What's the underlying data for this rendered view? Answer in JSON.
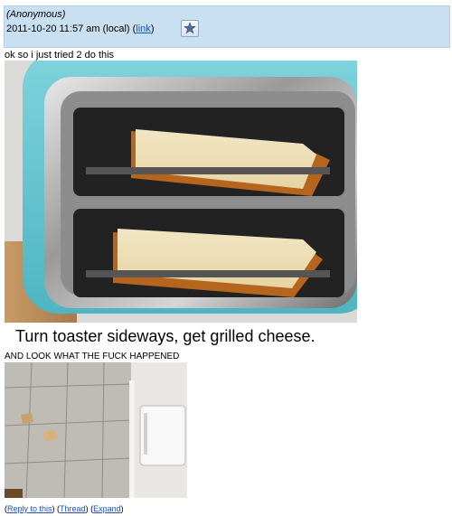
{
  "post": {
    "author": "(Anonymous)",
    "timestamp": "2011-10-20 11:57 am (local)",
    "link_label": "link",
    "star_icon": "star-pin-icon",
    "body": "ok so i just tried 2 do this",
    "image_caption": "Turn toaster sideways, get grilled cheese.",
    "follow_up": "AND LOOK WHAT THE FUCK HAPPENED"
  },
  "footer": {
    "reply_label": "Reply to this",
    "thread_label": "Thread",
    "expand_label": "Expand"
  },
  "colors": {
    "header_bg": "#c9e0f3",
    "link": "#1a4fc6",
    "toaster_teal": "#5fc3cf"
  }
}
